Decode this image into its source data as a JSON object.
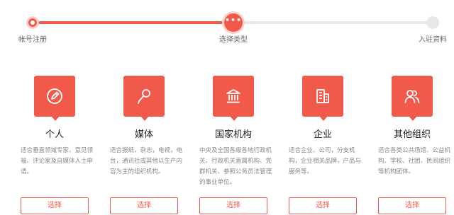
{
  "steps": [
    {
      "label": "帐号注册",
      "status": "done"
    },
    {
      "label": "选择类型",
      "status": "current",
      "icon": "more-dots-icon"
    },
    {
      "label": "入驻资料",
      "status": "todo"
    }
  ],
  "colors": {
    "accent": "#f15a4a",
    "accent_light": "#fbd3ce",
    "inactive": "#e6e7ec"
  },
  "cards": [
    {
      "title": "个人",
      "icon": "pencil-icon",
      "desc": "适合垂直领域专家、意见领袖、评论家及自媒体人士申请。",
      "button": "选择"
    },
    {
      "title": "媒体",
      "icon": "microphone-icon",
      "desc": "适合报纸，杂志，电视，电台，通讯社或其他以生产内容为主的组织机构。",
      "button": "选择"
    },
    {
      "title": "国家机构",
      "icon": "government-building-icon",
      "desc": "中央及全国各级各地行政机关、行政机关直属机构、党群机关、参照公务员法管理的事业单位。",
      "button": "选择"
    },
    {
      "title": "企业",
      "icon": "office-building-icon",
      "desc": "适合企业、公司，分支机构，企业相关品牌，产品与服务等。",
      "button": "选择"
    },
    {
      "title": "其他组织",
      "icon": "users-icon",
      "desc": "适合各类公共场馆、公益机构、学校、社团、民间组织等机构团体。",
      "button": "选择"
    }
  ]
}
